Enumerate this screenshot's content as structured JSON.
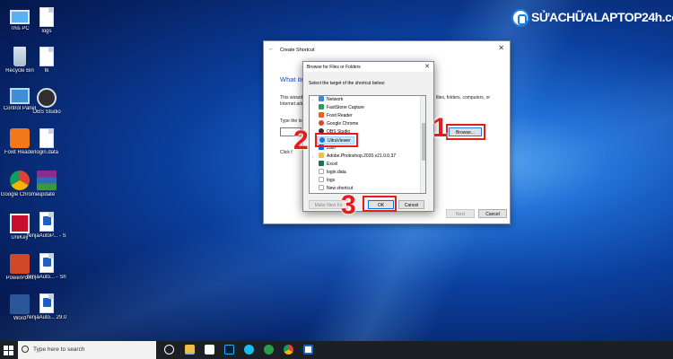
{
  "watermark": {
    "logo_text": "SỬACHỮALAPTOP24h.com"
  },
  "desktop_icons": [
    {
      "label": "This PC",
      "icon": "monitor-icon"
    },
    {
      "label": "logs",
      "icon": "document-icon"
    },
    {
      "label": "Recycle Bin",
      "icon": "recycle-bin-icon"
    },
    {
      "label": "tk",
      "icon": "document-icon"
    },
    {
      "label": "Control Panel",
      "icon": "control-panel-icon"
    },
    {
      "label": "OBS Studio",
      "icon": "obs-icon"
    },
    {
      "label": "Foxit Reader",
      "icon": "foxit-icon"
    },
    {
      "label": "login.data",
      "icon": "document-icon"
    },
    {
      "label": "Google Chrome",
      "icon": "chrome-icon"
    },
    {
      "label": "update",
      "icon": "winrar-icon"
    },
    {
      "label": "UniKey",
      "icon": "unikey-icon"
    },
    {
      "label": "NinjaAutoP... - Shortcut",
      "icon": "shortcut-icon"
    },
    {
      "label": "PowerPoint",
      "icon": "powerpoint-icon"
    },
    {
      "label": "NinjaAuto... - Shortcut",
      "icon": "shortcut-icon"
    },
    {
      "label": "Word",
      "icon": "word-icon"
    },
    {
      "label": "NinjaAuto... 29.01 - Sho...",
      "icon": "shortcut-icon"
    }
  ],
  "wizard": {
    "title": "Create Shortcut",
    "heading": "What ite",
    "line1": "This wizard",
    "line1_tail": "files, folders, computers, or",
    "line2": "Internet add",
    "type_label": "Type the loc",
    "click_label": "Click f",
    "browse_label": "Browse...",
    "next_label": "Next",
    "cancel_label": "Cancel"
  },
  "browse_dialog": {
    "title": "Browse for Files or Folders",
    "prompt": "Select the target of the shortcut below:",
    "items": [
      {
        "label": "Network",
        "icon": "network-icon",
        "color": "#3a8ad8",
        "expandable": true
      },
      {
        "label": "FastStone Capture",
        "icon": "faststone-icon",
        "color": "#2a9d4a",
        "expandable": false
      },
      {
        "label": "Foxit Reader",
        "icon": "foxit-icon",
        "color": "#e8601c",
        "expandable": false
      },
      {
        "label": "Google Chrome",
        "icon": "chrome-icon",
        "color": "#db4437",
        "expandable": false
      },
      {
        "label": "OBS Studio",
        "icon": "obs-icon",
        "color": "#333333",
        "expandable": false
      },
      {
        "label": "UltraViewer",
        "icon": "ultraviewer-icon",
        "color": "#1f74d8",
        "expandable": false,
        "selected": true
      },
      {
        "label": "Zalo",
        "icon": "zalo-icon",
        "color": "#0068ff",
        "expandable": false
      },
      {
        "label": "Adobe.Photoshop.2020.v21.0.0.37",
        "icon": "folder-icon",
        "color": "#e8c04a",
        "expandable": true
      },
      {
        "label": "Excel",
        "icon": "excel-icon",
        "color": "#1e7145",
        "expandable": false
      },
      {
        "label": "login.data",
        "icon": "document-icon",
        "color": "#dddddd",
        "expandable": false
      },
      {
        "label": "logs",
        "icon": "document-icon",
        "color": "#dddddd",
        "expandable": false
      },
      {
        "label": "New shortcut",
        "icon": "document-icon",
        "color": "#dddddd",
        "expandable": false
      }
    ],
    "make_new_label": "Make New Fo",
    "ok_label": "OK",
    "cancel_label": "Cancel"
  },
  "annotations": {
    "step1": "1",
    "step2": "2",
    "step3": "3",
    "color": "#e81b1b"
  },
  "taskbar": {
    "search_placeholder": "Type here to search",
    "apps": [
      "cortana-icon",
      "task-view-icon",
      "file-explorer-icon",
      "store-icon",
      "photoshop-icon",
      "ie-icon",
      "edge-icon",
      "chrome-icon",
      "shortcut-icon"
    ]
  }
}
